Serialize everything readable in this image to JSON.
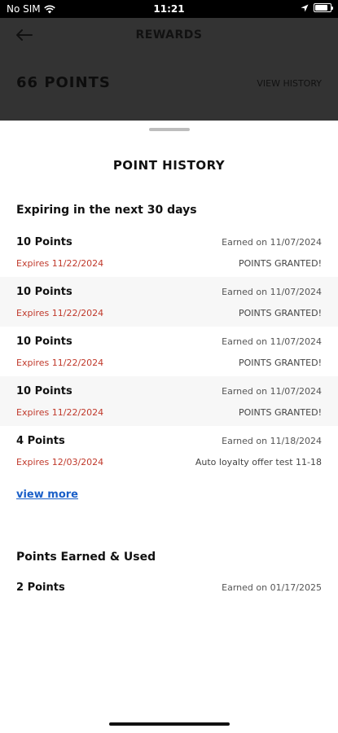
{
  "status_bar": {
    "carrier": "No SIM",
    "time": "11:21"
  },
  "header": {
    "title": "REWARDS",
    "points": "66 POINTS",
    "view_history": "VIEW HISTORY"
  },
  "sheet": {
    "title": "POINT HISTORY",
    "expiring_heading": "Expiring in the next 30 days",
    "expiring_rows": [
      {
        "points": "10 Points",
        "earned": "Earned on 11/07/2024",
        "expires": "Expires 11/22/2024",
        "note": "POINTS GRANTED!"
      },
      {
        "points": "10 Points",
        "earned": "Earned on 11/07/2024",
        "expires": "Expires 11/22/2024",
        "note": "POINTS GRANTED!"
      },
      {
        "points": "10 Points",
        "earned": "Earned on 11/07/2024",
        "expires": "Expires 11/22/2024",
        "note": "POINTS GRANTED!"
      },
      {
        "points": "10 Points",
        "earned": "Earned on 11/07/2024",
        "expires": "Expires 11/22/2024",
        "note": "POINTS GRANTED!"
      },
      {
        "points": "4 Points",
        "earned": "Earned on 11/18/2024",
        "expires": "Expires 12/03/2024",
        "note": "Auto loyalty offer test 11-18"
      }
    ],
    "view_more": "view more",
    "earned_used_heading": "Points Earned & Used",
    "earned_used_rows": [
      {
        "points": "2 Points",
        "earned": "Earned on 01/17/2025"
      }
    ]
  },
  "colors": {
    "expires": "#c0392b",
    "link": "#1a5fc8",
    "overlay": "#333333"
  }
}
